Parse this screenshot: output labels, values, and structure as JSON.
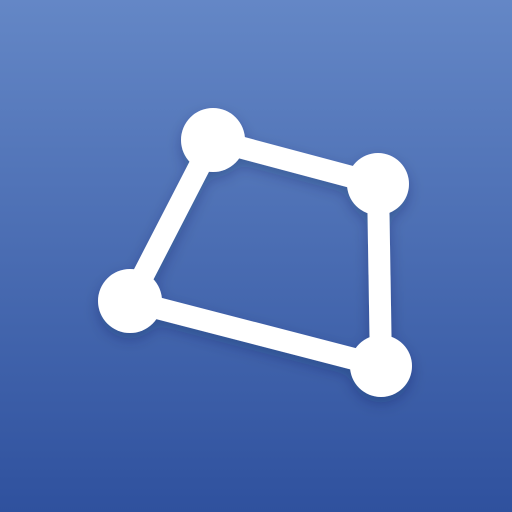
{
  "icon": {
    "semantic_name": "quadrilateral-polygon-icon",
    "colors": {
      "background_top": "#6487C6",
      "background_bottom": "#2F519E",
      "glyph": "#FFFFFF"
    }
  }
}
